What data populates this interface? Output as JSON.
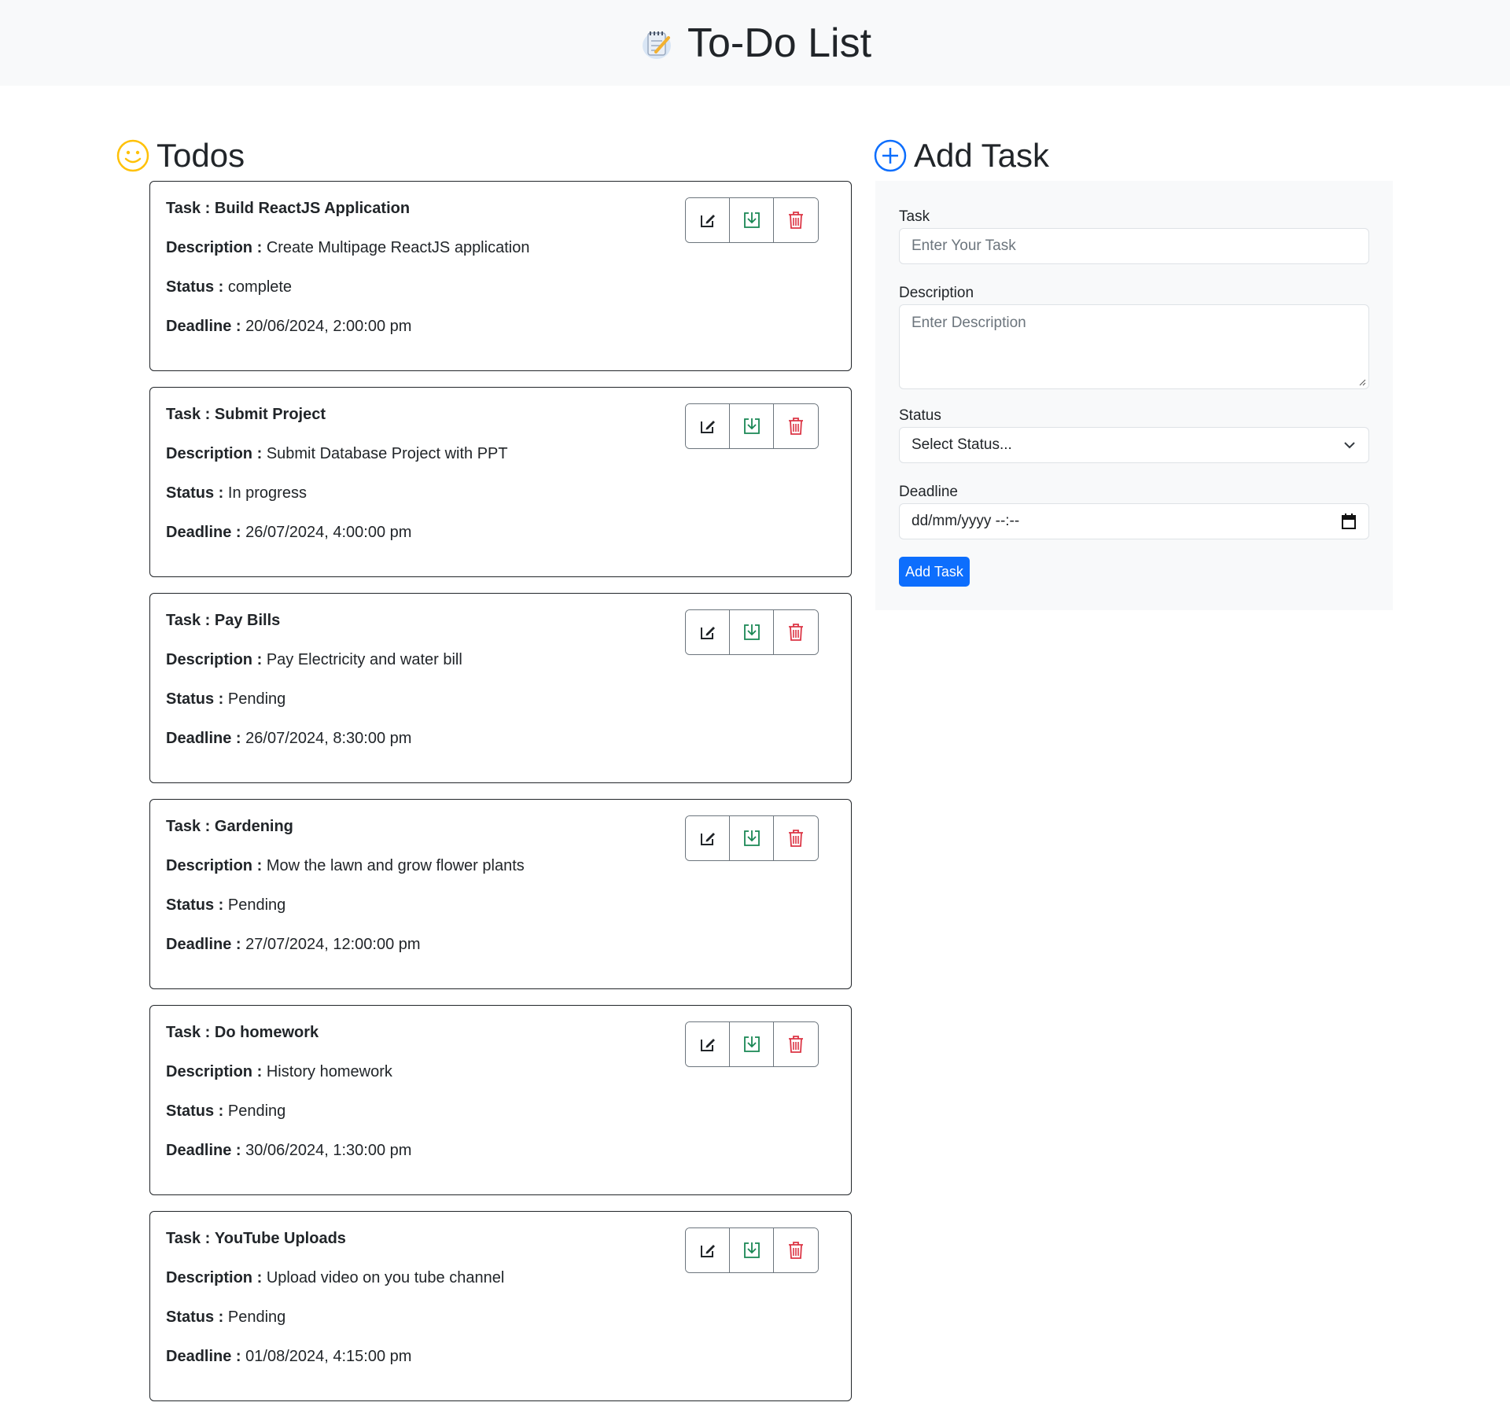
{
  "header": {
    "title": "To-Do List",
    "logo_icon": "notepad-icon"
  },
  "todos_section": {
    "title": "Todos",
    "icon": "smiley-icon"
  },
  "add_section": {
    "title": "Add Task",
    "icon": "plus-circle-icon"
  },
  "labels": {
    "task": "Task :",
    "description": "Description :",
    "status": "Status :",
    "deadline": "Deadline :"
  },
  "todos": [
    {
      "task": "Build ReactJS Application",
      "description": "Create Multipage ReactJS application",
      "status": "complete",
      "deadline": "20/06/2024, 2:00:00 pm"
    },
    {
      "task": "Submit Project",
      "description": "Submit Database Project with PPT",
      "status": "In progress",
      "deadline": "26/07/2024, 4:00:00 pm"
    },
    {
      "task": "Pay Bills",
      "description": "Pay Electricity and water bill",
      "status": "Pending",
      "deadline": "26/07/2024, 8:30:00 pm"
    },
    {
      "task": "Gardening",
      "description": "Mow the lawn and grow flower plants",
      "status": "Pending",
      "deadline": "27/07/2024, 12:00:00 pm"
    },
    {
      "task": "Do homework",
      "description": "History homework",
      "status": "Pending",
      "deadline": "30/06/2024, 1:30:00 pm"
    },
    {
      "task": "YouTube Uploads",
      "description": "Upload video on you tube channel",
      "status": "Pending",
      "deadline": "01/08/2024, 4:15:00 pm"
    }
  ],
  "form": {
    "task_label": "Task",
    "task_placeholder": "Enter Your Task",
    "description_label": "Description",
    "description_placeholder": "Enter Description",
    "status_label": "Status",
    "status_selected": "Select Status...",
    "deadline_label": "Deadline",
    "deadline_value": "dd/mm/yyyy --:--",
    "submit_label": "Add Task"
  },
  "colors": {
    "edit": "#212529",
    "save": "#198754",
    "delete": "#dc3545",
    "primary": "#0d6efd",
    "smiley": "#ffc107"
  }
}
